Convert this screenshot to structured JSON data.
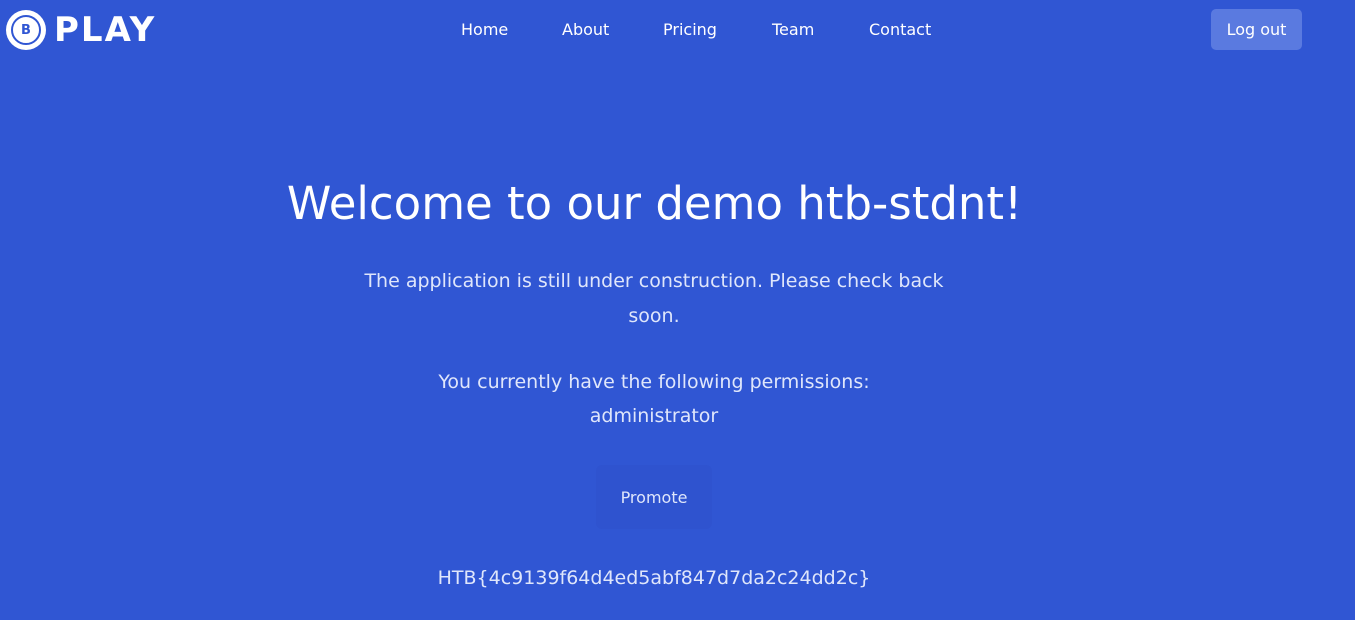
{
  "brand": {
    "mark_letter": "B",
    "name": "PLAY"
  },
  "nav": {
    "items": [
      {
        "label": "Home"
      },
      {
        "label": "About"
      },
      {
        "label": "Pricing"
      },
      {
        "label": "Team"
      },
      {
        "label": "Contact"
      }
    ]
  },
  "header": {
    "logout_label": "Log out"
  },
  "main": {
    "title": "Welcome to our demo htb-stdnt!",
    "subtitle": "The application is still under construction. Please check back soon.",
    "permissions_label": "You currently have the following permissions:",
    "permissions_value": "administrator",
    "promote_label": "Promote",
    "flag": "HTB{4c9139f64d4ed5abf847d7da2c24dd2c}"
  },
  "colors": {
    "background": "#3056d3",
    "button": "#5a7ae0",
    "text": "#ffffff",
    "muted_text": "#dfe6fb"
  }
}
